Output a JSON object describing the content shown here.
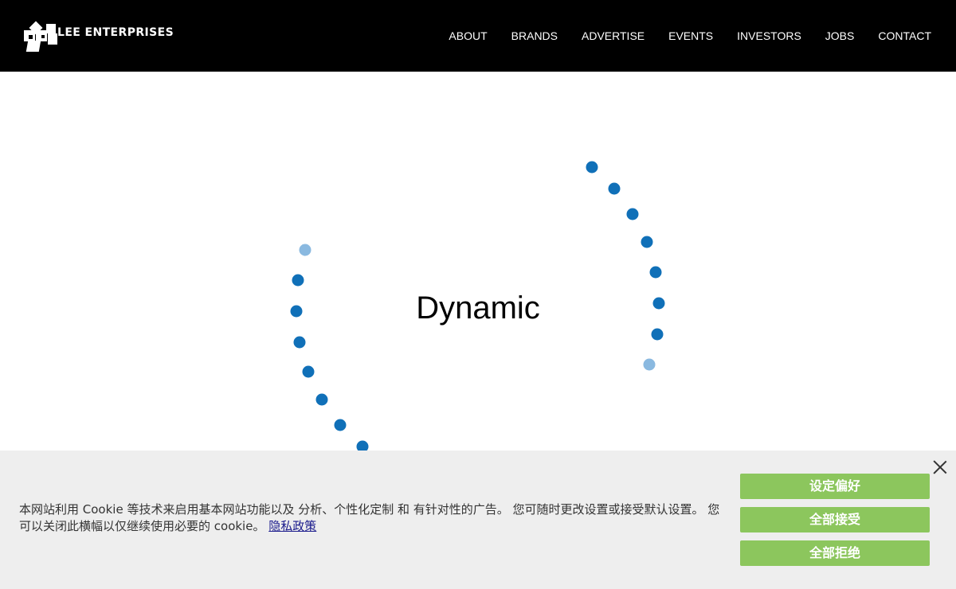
{
  "header": {
    "logo_text": "LEE ENTERPRISES",
    "nav": [
      "ABOUT",
      "BRANDS",
      "ADVERTISE",
      "EVENTS",
      "INVESTORS",
      "JOBS",
      "CONTACT"
    ]
  },
  "hero": {
    "word": "Dynamic",
    "colors": {
      "dot": "#1070b8",
      "dot_faded": "#8ab9e0"
    }
  },
  "cookie": {
    "message": "本网站利用 Cookie 等技术来启用基本网站功能以及 分析、个性化定制 和 有针对性的广告。 您可随时更改设置或接受默认设置。 您可以关闭此横幅以仅继续使用必要的 cookie。",
    "privacy_link": "隐私政策",
    "buttons": {
      "preferences": "设定偏好",
      "accept_all": "全部接受",
      "reject_all": "全部拒绝"
    },
    "close_icon": "close-icon",
    "colors": {
      "button": "#8cc65d",
      "background": "#eeeeee"
    }
  }
}
